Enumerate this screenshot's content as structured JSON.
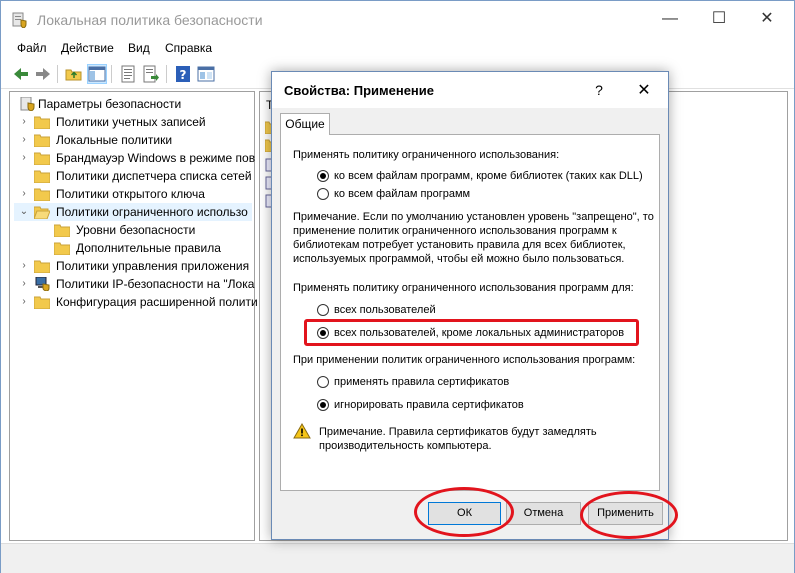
{
  "window": {
    "title": "Локальная политика безопасности",
    "minimize": "—",
    "maximize": "☐",
    "close": "✕"
  },
  "menu": [
    "Файл",
    "Действие",
    "Вид",
    "Справка"
  ],
  "tree": {
    "items": [
      {
        "label": "Параметры безопасности",
        "chevron": ""
      },
      {
        "label": "Политики учетных записей",
        "chevron": "›"
      },
      {
        "label": "Локальные политики",
        "chevron": "›"
      },
      {
        "label": "Брандмауэр Windows в режиме пов",
        "chevron": "›"
      },
      {
        "label": "Политики диспетчера списка сетей",
        "chevron": ""
      },
      {
        "label": "Политики открытого ключа",
        "chevron": "›"
      },
      {
        "label": "Политики ограниченного использо",
        "chevron": "⌄"
      },
      {
        "label": "Уровни безопасности",
        "chevron": ""
      },
      {
        "label": "Дополнительные правила",
        "chevron": ""
      },
      {
        "label": "Политики управления приложения",
        "chevron": "›"
      },
      {
        "label": "Политики IP-безопасности на \"Лока",
        "chevron": "›"
      },
      {
        "label": "Конфигурация расширенной полити",
        "chevron": "›"
      }
    ]
  },
  "right_pane": {
    "col_head": "Т"
  },
  "dialog": {
    "title": "Свойства: Применение",
    "help": "?",
    "close": "✕",
    "tab": "Общие",
    "section1_label": "Применять политику ограниченного использования:",
    "option1a": "ко всем файлам программ, кроме библиотек (таких как DLL)",
    "option1b": "ко всем файлам программ",
    "note1": "Примечание. Если по умолчанию установлен уровень \"запрещено\", то применение политик ограниченного использования программ к библиотекам потребует установить правила для всех библиотек, используемых программой, чтобы ей можно было пользоваться.",
    "section2_label": "Применять политику ограниченного использования программ для:",
    "option2a": "всех пользователей",
    "option2b": "всех пользователей, кроме локальных администраторов",
    "section3_label": "При применении политик ограниченного использования программ:",
    "option3a": "применять правила сертификатов",
    "option3b": "игнорировать правила сертификатов",
    "note2": "Примечание. Правила сертификатов будут замедлять производительность компьютера.",
    "ok": "ОК",
    "cancel": "Отмена",
    "apply": "Применить"
  },
  "colors": {
    "highlight": "#e2141d",
    "selection": "#cce8ff",
    "accent": "#0078d7"
  }
}
